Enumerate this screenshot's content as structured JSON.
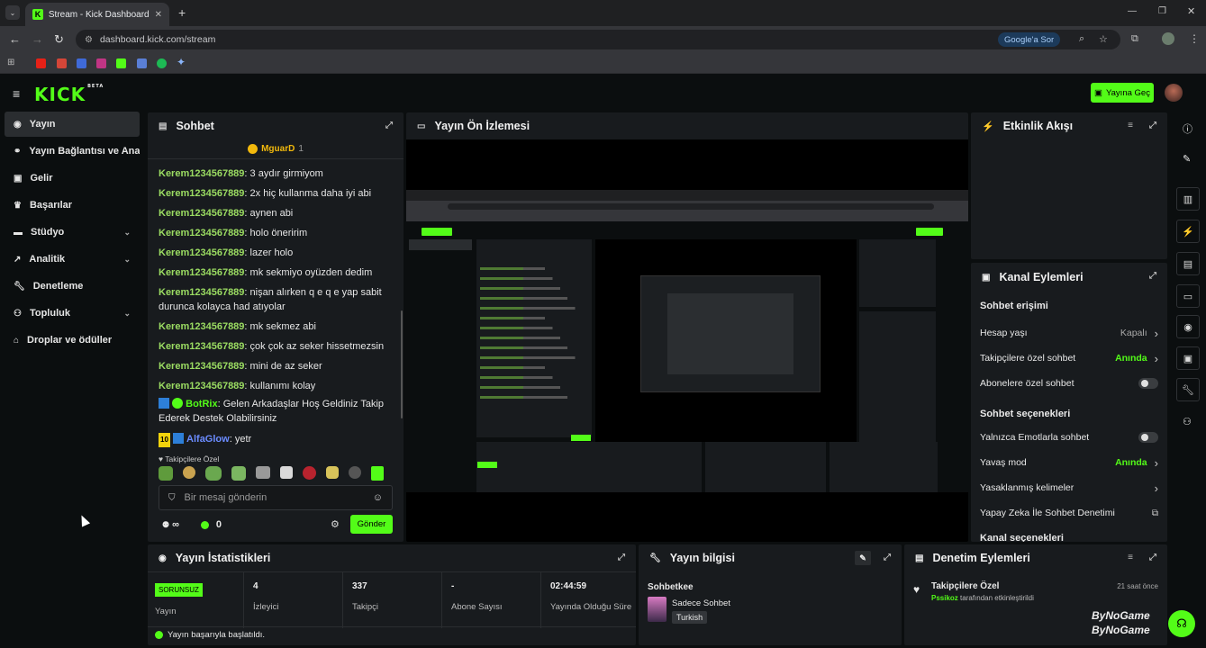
{
  "browser": {
    "tab_title": "Stream - Kick Dashboard",
    "url": "dashboard.kick.com/stream",
    "google_ask": "Google'a Sor"
  },
  "app": {
    "logo": "KICK",
    "logo_badge": "BETA",
    "go_live": "Yayına Geç"
  },
  "sidebar": {
    "items": [
      {
        "label": "Yayın",
        "icon": "broadcast-icon"
      },
      {
        "label": "Yayın Bağlantısı ve Anahtarı",
        "icon": "link-icon"
      },
      {
        "label": "Gelir",
        "icon": "revenue-icon"
      },
      {
        "label": "Başarılar",
        "icon": "trophy-icon"
      },
      {
        "label": "Stüdyo",
        "icon": "studio-icon"
      },
      {
        "label": "Analitik",
        "icon": "analytics-icon"
      },
      {
        "label": "Denetleme",
        "icon": "wrench-icon"
      },
      {
        "label": "Topluluk",
        "icon": "community-icon"
      },
      {
        "label": "Droplar ve ödüller",
        "icon": "gift-icon"
      }
    ]
  },
  "chat": {
    "title": "Sohbet",
    "pinned_user": "MguarD",
    "pinned_count": "1",
    "messages": [
      {
        "user": "Kerem1234567889",
        "text": "3 aydır girmiyom"
      },
      {
        "user": "Kerem1234567889",
        "text": "2x hiç kullanma daha iyi abi"
      },
      {
        "user": "Kerem1234567889",
        "text": "aynen abi"
      },
      {
        "user": "Kerem1234567889",
        "text": "holo öneririm"
      },
      {
        "user": "Kerem1234567889",
        "text": "lazer holo"
      },
      {
        "user": "Kerem1234567889",
        "text": "mk sekmiyo oyüzden dedim"
      },
      {
        "user": "Kerem1234567889",
        "text": "nişan alırken q e q e yap sabit durunca kolayca had atıyolar"
      },
      {
        "user": "Kerem1234567889",
        "text": "mk sekmez abi"
      },
      {
        "user": "Kerem1234567889",
        "text": "çok çok az seker hissetmezsin"
      },
      {
        "user": "Kerem1234567889",
        "text": "mini de az seker"
      },
      {
        "user": "Kerem1234567889",
        "text": "kullanımı kolay"
      }
    ],
    "botrix_user": "BotRix",
    "botrix_text": "Gelen Arkadaşlar Hoş Geldiniz Takip Ederek Destek Olabilirsiniz",
    "alfa_badge": "10",
    "alfa_user": "AlfaGlow",
    "alfa_text": "yetr",
    "followers_only_label": "Takipçilere Özel",
    "input_placeholder": "Bir mesaj gönderin",
    "infinity": "∞",
    "points": "0",
    "send": "Gönder"
  },
  "preview": {
    "title": "Yayın Ön İzlemesi"
  },
  "activity": {
    "title": "Etkinlik Akışı"
  },
  "channel_actions": {
    "title": "Kanal Eylemleri",
    "chat_access": "Sohbet erişimi",
    "rows1": [
      {
        "label": "Hesap yaşı",
        "value": "Kapalı",
        "kind": "link"
      },
      {
        "label": "Takipçilere özel sohbet",
        "value": "Anında",
        "kind": "link-green"
      },
      {
        "label": "Abonelere özel sohbet",
        "value": "",
        "kind": "toggle"
      }
    ],
    "chat_options": "Sohbet seçenekleri",
    "rows2": [
      {
        "label": "Yalnızca Emotlarla sohbet",
        "value": "",
        "kind": "toggle"
      },
      {
        "label": "Yavaş mod",
        "value": "Anında",
        "kind": "link-green"
      },
      {
        "label": "Yasaklanmış kelimeler",
        "value": "",
        "kind": "link"
      },
      {
        "label": "Yapay Zeka İle Sohbet Denetimi",
        "value": "",
        "kind": "external"
      }
    ],
    "channel_options": "Kanal seçenekleri"
  },
  "stats": {
    "title": "Yayın İstatistikleri",
    "status_badge": "SORUNSUZ",
    "status_label": "Yayın",
    "items": [
      {
        "value": "4",
        "label": "İzleyici"
      },
      {
        "value": "337",
        "label": "Takipçi"
      },
      {
        "value": "-",
        "label": "Abone Sayısı"
      },
      {
        "value": "02:44:59",
        "label": "Yayında Olduğu Süre"
      }
    ],
    "success_msg": "Yayın başarıyla başlatıldı."
  },
  "stream_info": {
    "title": "Yayın bilgisi",
    "stream_title": "Sohbetkee",
    "category": "Sadece Sohbet",
    "tag": "Turkish"
  },
  "moderation": {
    "title": "Denetim Eylemleri",
    "event_title": "Takipçilere Özel",
    "event_time": "21 saat önce",
    "event_actor": "Pssikoz",
    "event_text": "tarafından etkinleştirildi"
  },
  "watermark": {
    "line1": "ByNoGame",
    "line2": "ByNoGame"
  },
  "colors": {
    "kick_green": "#53fc18",
    "panel_bg": "#181b1e",
    "page_bg": "#0b0e0f",
    "username_green": "#9bdc62"
  }
}
